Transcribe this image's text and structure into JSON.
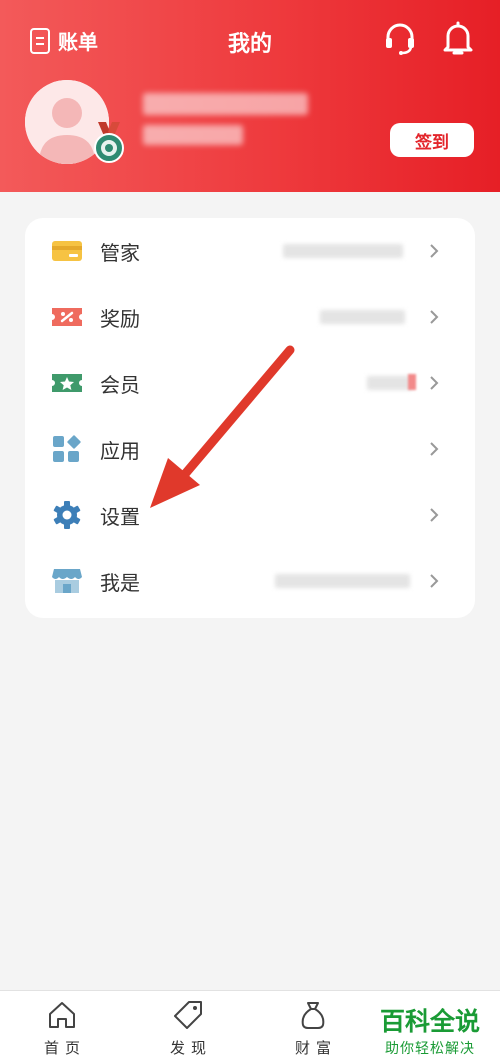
{
  "header": {
    "bill_label": "账单",
    "title": "我的",
    "headset_icon": "customer-service-icon",
    "bell_icon": "bell-icon",
    "signin_label": "签到",
    "accent": "#e3262c"
  },
  "menu": {
    "items": [
      {
        "label": "管家",
        "icon": "card-icon",
        "color": "#f6c343"
      },
      {
        "label": "奖励",
        "icon": "coupon-icon",
        "color": "#ef6b5e"
      },
      {
        "label": "会员",
        "icon": "member-ticket-icon",
        "color": "#3f9a6b"
      },
      {
        "label": "应用",
        "icon": "apps-grid-icon",
        "color": "#6aa6c9"
      },
      {
        "label": "设置",
        "icon": "gear-icon",
        "color": "#3d7fb8"
      },
      {
        "label": "我是",
        "icon": "store-icon",
        "color": "#6aa6c9"
      }
    ]
  },
  "tabbar": {
    "tabs": [
      {
        "label": "首页",
        "icon": "home-icon"
      },
      {
        "label": "发现",
        "icon": "tag-icon"
      },
      {
        "label": "财富",
        "icon": "money-bag-icon"
      }
    ]
  },
  "watermark": {
    "title": "百科全说",
    "subtitle": "助你轻松解决"
  }
}
